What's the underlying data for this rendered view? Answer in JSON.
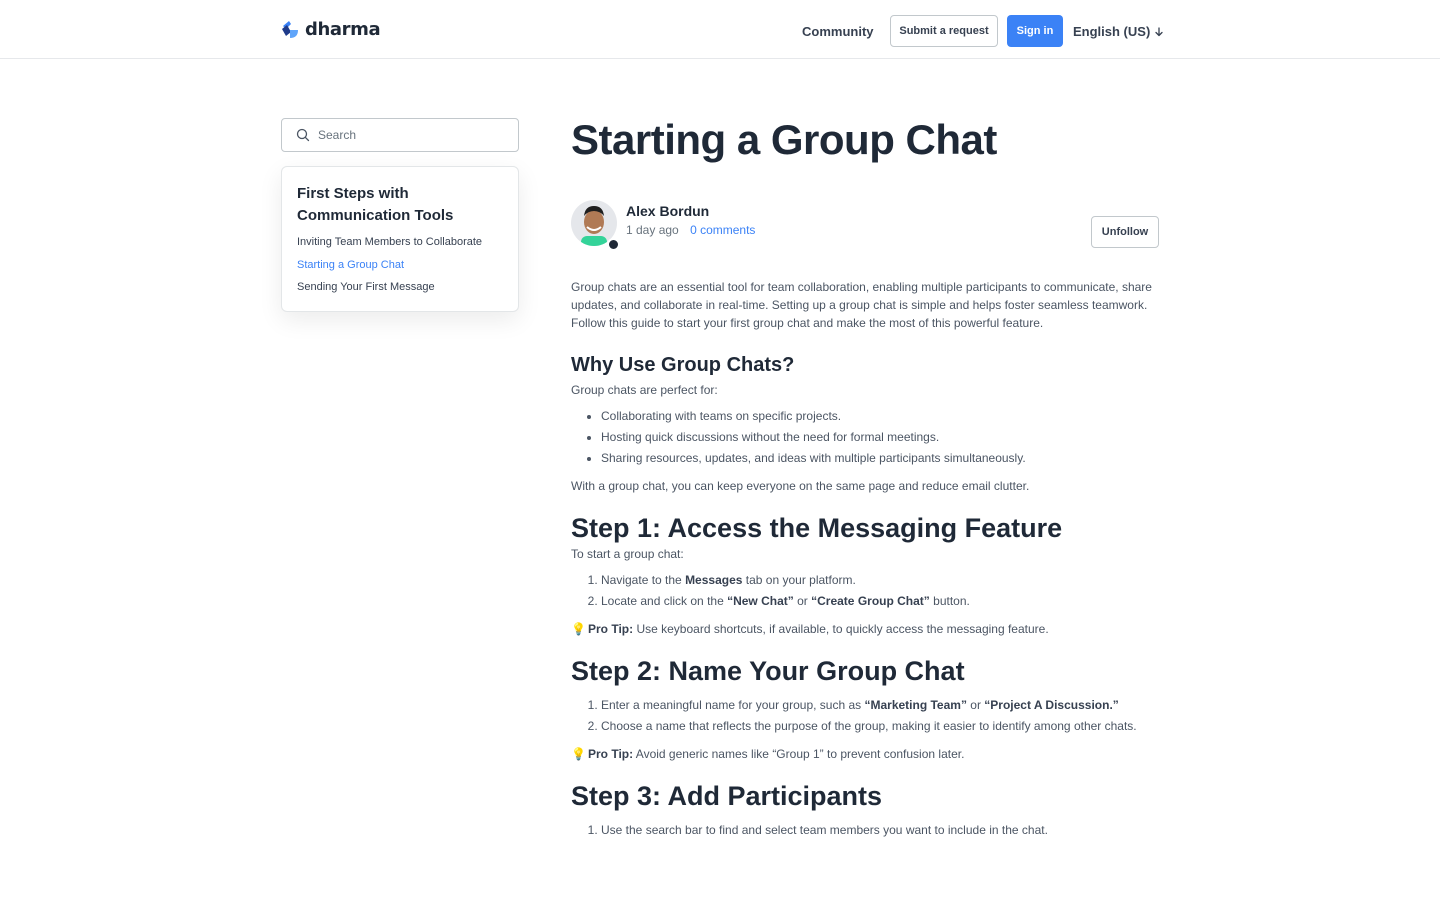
{
  "header": {
    "logo_text": "dharma",
    "nav_community": "Community",
    "submit_request": "Submit a request",
    "sign_in": "Sign in",
    "language": "English (US)",
    "language_icon": "arrow-down-icon",
    "accent_color": "#3b82f6"
  },
  "sidebar": {
    "search_placeholder": "Search",
    "section_title": "First Steps with Communication Tools",
    "links": [
      "Inviting Team Members to Collaborate",
      "Starting a Group Chat",
      "Sending Your First Message"
    ],
    "active_link": "Starting a Group Chat"
  },
  "article": {
    "title": "Starting a Group Chat",
    "author": "Alex Bordun",
    "time": "1 day ago",
    "comments": "0 comments",
    "unfollow": "Unfollow",
    "intro": "Group chats are an essential tool for team collaboration, enabling multiple participants to communicate, share updates, and collaborate in real-time. Setting up a group chat is simple and helps foster seamless teamwork. Follow this guide to start your first group chat and make the most of this powerful feature.",
    "why_heading": "Why Use Group Chats?",
    "why_lead": "Group chats are perfect for:",
    "why_items": [
      "Collaborating with teams on specific projects.",
      "Hosting quick discussions without the need for formal meetings.",
      "Sharing resources, updates, and ideas with multiple participants simultaneously."
    ],
    "why_outro": "With a group chat, you can keep everyone on the same page and reduce email clutter.",
    "step1_heading": "Step 1: Access the Messaging Feature",
    "step1_lead": "To start a group chat:",
    "step1_item1_pre": "Navigate to the ",
    "step1_item1_bold": "Messages",
    "step1_item1_post": " tab on your platform.",
    "step1_item2_pre": "Locate and click on the ",
    "step1_item2_bold1": "“New Chat”",
    "step1_item2_mid": " or ",
    "step1_item2_bold2": "“Create Group Chat”",
    "step1_item2_post": " button.",
    "pro_tip_label": "Pro Tip:",
    "step1_tip": " Use keyboard shortcuts, if available, to quickly access the messaging feature.",
    "step2_heading": "Step 2: Name Your Group Chat",
    "step2_item1_pre": "Enter a meaningful name for your group, such as ",
    "step2_item1_bold1": "“Marketing Team”",
    "step2_item1_mid": " or ",
    "step2_item1_bold2": "“Project A Discussion.”",
    "step2_item2": "Choose a name that reflects the purpose of the group, making it easier to identify among other chats.",
    "step2_tip": " Avoid generic names like “Group 1” to prevent confusion later.",
    "step3_heading": "Step 3: Add Participants",
    "step3_item1": "Use the search bar to find and select team members you want to include in the chat.",
    "tip_icon": "lightbulb-icon"
  }
}
